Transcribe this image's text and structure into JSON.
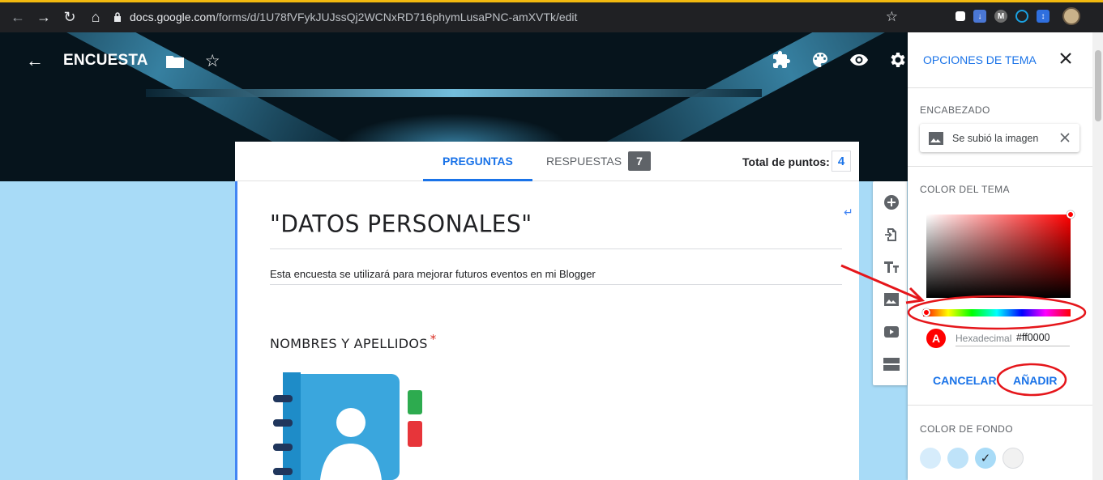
{
  "browser": {
    "url_host": "docs.google.com",
    "url_path": "/forms/d/1U78fVFykJUJssQj2WCNxRD716phymLusaPNC-amXVTk/edit"
  },
  "header": {
    "title": "ENCUESTA"
  },
  "tabs": {
    "questions": "PREGUNTAS",
    "responses": "RESPUESTAS",
    "responses_count": "7",
    "points_label": "Total de puntos:",
    "points_value": "4"
  },
  "form": {
    "title": "\"DATOS PERSONALES\"",
    "description": "Esta encuesta se utilizará para mejorar futuros eventos en mi Blogger",
    "question_title": "NOMBRES Y APELLIDOS",
    "required_mark": "*"
  },
  "panel": {
    "title": "OPCIONES DE TEMA",
    "header_section": "ENCABEZADO",
    "uploaded_label": "Se subió la imagen",
    "theme_color_section": "COLOR DEL TEMA",
    "swatch_letter": "A",
    "hex_label": "Hexadecimal",
    "hex_value": "#ff0000",
    "cancel_label": "CANCELAR",
    "add_label": "AÑADIR",
    "background_section": "COLOR DE FONDO"
  },
  "colors": {
    "accent": "#1a73e8",
    "theme_selected": "#ff0000",
    "background": "#a8dbf7",
    "annotation": "#e5161b",
    "bg_swatches": [
      "#d6ecfb",
      "#bfe3f9",
      "#a8dbf7",
      "#f1f1f1"
    ]
  },
  "icons": {
    "toolbar": [
      "add-question-icon",
      "import-questions-icon",
      "title-text-icon",
      "add-image-icon",
      "add-video-icon",
      "add-section-icon"
    ],
    "top_right": [
      "addons-icon",
      "palette-icon",
      "preview-eye-icon",
      "settings-gear-icon"
    ]
  }
}
